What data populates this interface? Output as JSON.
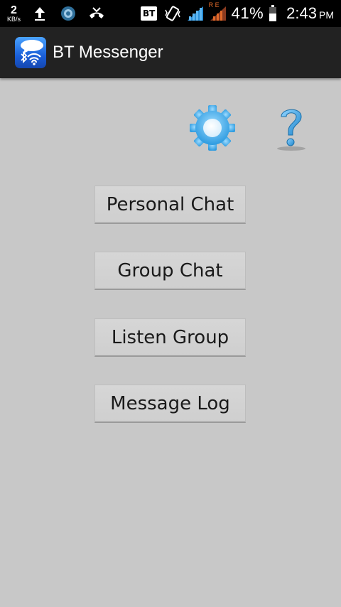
{
  "status_bar": {
    "net_speed_value": "2",
    "net_speed_unit": "KB/s",
    "sim_badge": "BT",
    "network_type": "R E",
    "battery_percent": "41%",
    "time": "2:43",
    "ampm": "PM",
    "icons": [
      "upload-icon",
      "app-notification-icon",
      "missed-call-icon",
      "bt-badge-icon",
      "vibrate-icon",
      "signal-icon",
      "signal-roaming-icon",
      "battery-icon"
    ]
  },
  "action_bar": {
    "title": "BT Messenger",
    "icon": "bt-messenger-app-icon"
  },
  "toolbar": {
    "settings_icon": "gear-icon",
    "help_icon": "question-icon",
    "accent_color": "#4db8f0"
  },
  "menu": {
    "personal_chat": "Personal Chat",
    "group_chat": "Group Chat",
    "listen_group": "Listen Group",
    "message_log": "Message Log"
  }
}
